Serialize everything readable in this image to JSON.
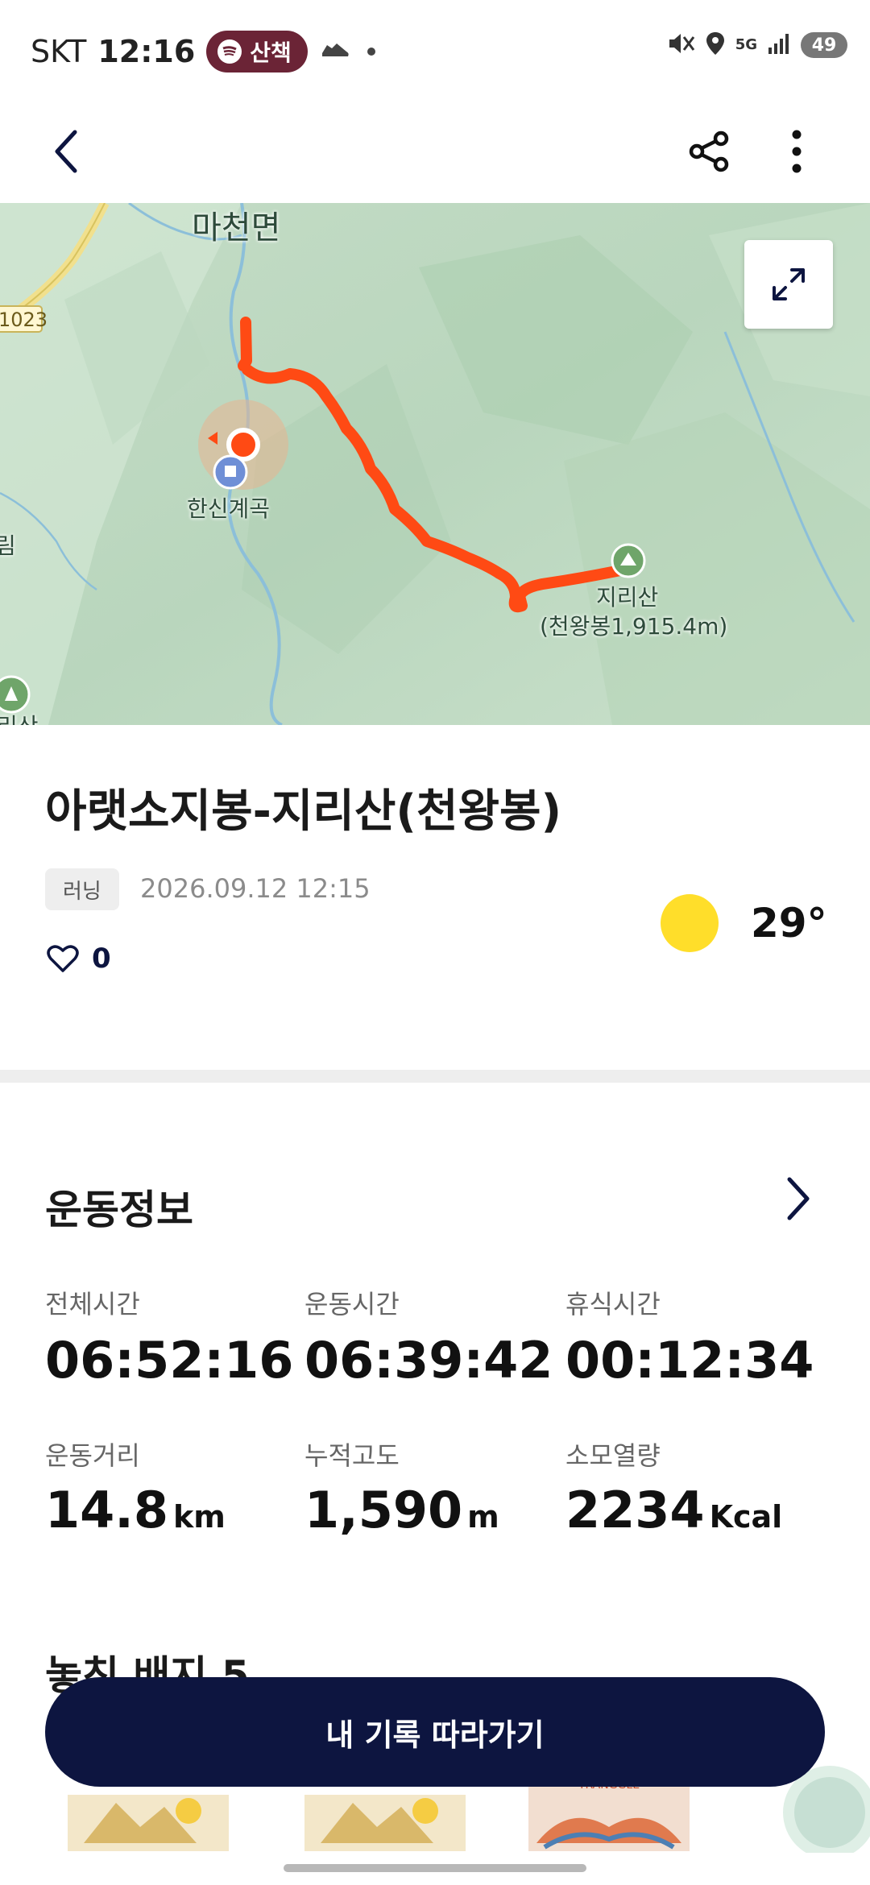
{
  "status_bar": {
    "carrier": "SKT",
    "time": "12:16",
    "music_label": "산책",
    "battery": "49",
    "network": "5G"
  },
  "header": {
    "back_icon": "chevron-left-icon",
    "share_icon": "share-icon",
    "more_icon": "more-vertical-icon"
  },
  "map": {
    "labels": {
      "town": "마천면",
      "road": "1023",
      "valley": "한신계곡",
      "peak_name": "지리산",
      "peak_detail": "(천왕봉1,915.4m)",
      "edge_left": "림",
      "edge_bottom": "리산"
    },
    "route_color": "#ff4a14"
  },
  "record": {
    "title": "아랫소지봉-지리산(천왕봉)",
    "activity_tag": "러닝",
    "datetime": "2026.09.12 12:15",
    "likes": "0",
    "temperature": "29°"
  },
  "exercise_info": {
    "title": "운동정보",
    "stats": [
      {
        "label": "전체시간",
        "value": "06:52:16",
        "unit": ""
      },
      {
        "label": "운동시간",
        "value": "06:39:42",
        "unit": ""
      },
      {
        "label": "휴식시간",
        "value": "00:12:34",
        "unit": ""
      },
      {
        "label": "운동거리",
        "value": "14.8",
        "unit": "km"
      },
      {
        "label": "누적고도",
        "value": "1,590",
        "unit": "m"
      },
      {
        "label": "소모열량",
        "value": "2234",
        "unit": "Kcal"
      }
    ]
  },
  "badges": {
    "title": "놓친 배지 5",
    "partial_badge_text": "TRANGGLE"
  },
  "cta": {
    "label": "내 기록 따라가기"
  },
  "colors": {
    "primary": "#0d1540",
    "route": "#ff4a14",
    "sun": "#ffde2a",
    "music_chip": "#6b2436"
  }
}
